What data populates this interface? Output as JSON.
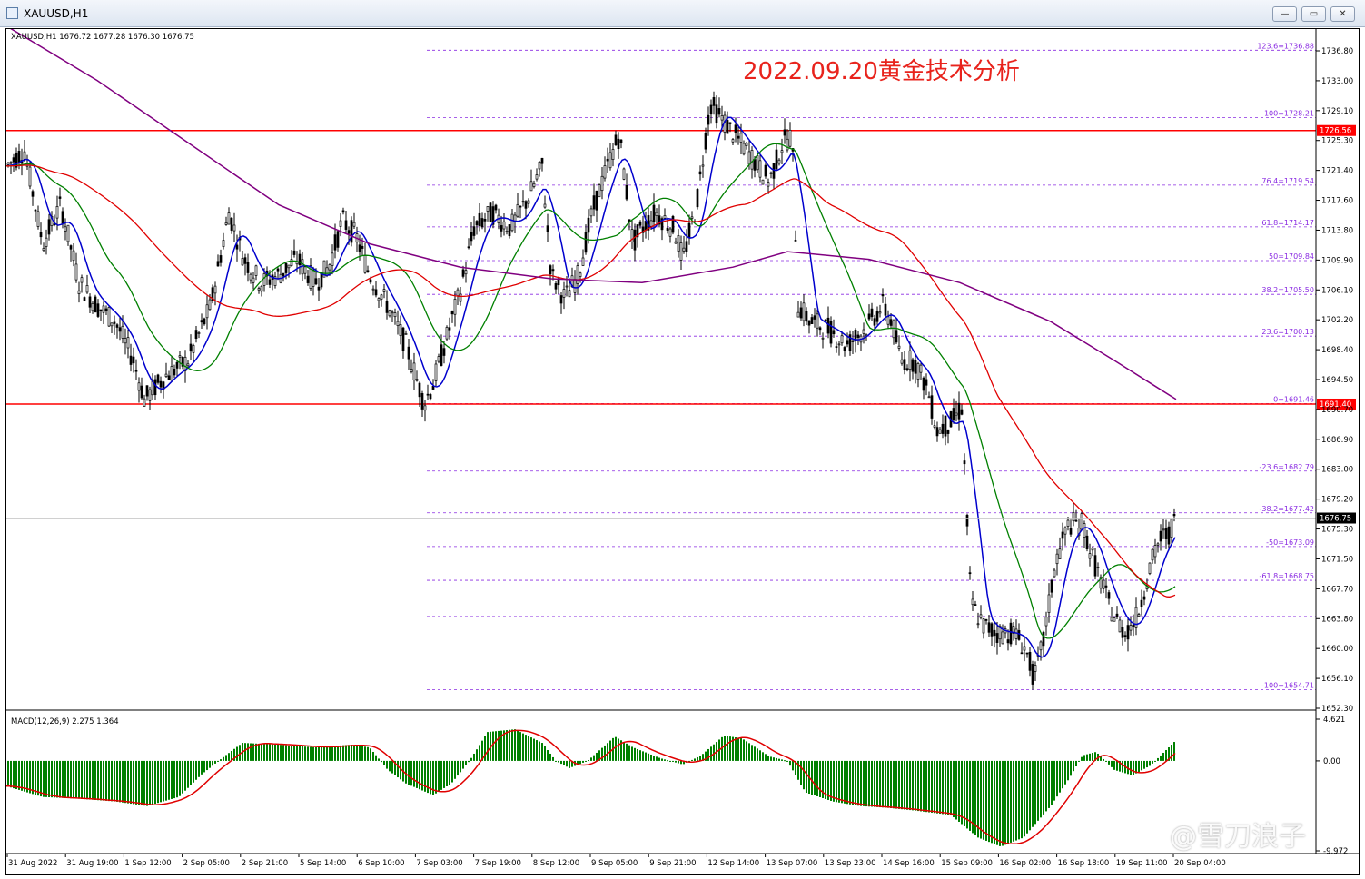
{
  "window": {
    "title": "XAUUSD,H1",
    "buttons": {
      "minimize": "—",
      "restore": "▭",
      "close": "✕"
    }
  },
  "chart": {
    "info_line": "XAUUSD,H1  1676.72 1677.28 1676.30 1676.75",
    "overlay_title": "2022.09.20黄金技术分析",
    "watermark": "@雪刀浪子",
    "price_axis": [
      "1736.80",
      "1733.00",
      "1729.10",
      "1725.30",
      "1721.40",
      "1717.60",
      "1713.80",
      "1709.90",
      "1706.10",
      "1702.20",
      "1698.40",
      "1694.50",
      "1690.70",
      "1686.90",
      "1683.00",
      "1679.20",
      "1675.30",
      "1671.50",
      "1667.70",
      "1663.80",
      "1660.00",
      "1656.10",
      "1652.30"
    ],
    "current_price": "1676.75",
    "horizontal_lines": [
      {
        "label": "1726.56",
        "price": 1726.56,
        "color": "#ff0000"
      },
      {
        "label": "1691.40",
        "price": 1691.4,
        "color": "#ff0000"
      }
    ],
    "fib_levels": [
      {
        "label": "123.6=1736.88",
        "price": 1736.88
      },
      {
        "label": "100=1728.21",
        "price": 1728.21
      },
      {
        "label": "76.4=1719.54",
        "price": 1719.54
      },
      {
        "label": "61.8=1714.17",
        "price": 1714.17
      },
      {
        "label": "50=1709.84",
        "price": 1709.84
      },
      {
        "label": "38.2=1705.50",
        "price": 1705.5
      },
      {
        "label": "23.6=1700.13",
        "price": 1700.13
      },
      {
        "label": "0=1691.46",
        "price": 1691.46
      },
      {
        "label": "-23.6=1682.79",
        "price": 1682.79
      },
      {
        "label": "-38.2=1677.42",
        "price": 1677.42
      },
      {
        "label": "-50=1673.09",
        "price": 1673.09
      },
      {
        "label": "-61.8=1668.75",
        "price": 1668.75
      },
      {
        "label": "",
        "price": 1664.1
      },
      {
        "label": "-100=1654.71",
        "price": 1654.71
      }
    ],
    "time_axis": [
      "31 Aug 2022",
      "31 Aug 19:00",
      "1 Sep 12:00",
      "2 Sep 05:00",
      "2 Sep 21:00",
      "5 Sep 14:00",
      "6 Sep 10:00",
      "7 Sep 03:00",
      "7 Sep 19:00",
      "8 Sep 12:00",
      "9 Sep 05:00",
      "9 Sep 21:00",
      "12 Sep 14:00",
      "13 Sep 07:00",
      "13 Sep 23:00",
      "14 Sep 16:00",
      "15 Sep 09:00",
      "16 Sep 02:00",
      "16 Sep 18:00",
      "19 Sep 11:00",
      "20 Sep 04:00"
    ],
    "colors": {
      "up": "#000000",
      "fast_ma": "#0000cd",
      "mid_ma": "#008000",
      "slow_ma": "#e00000",
      "long_ma": "#800080",
      "hline": "#ff0000",
      "fib": "#8a2be2",
      "macd_hist": "#008000",
      "macd_signal": "#e00000"
    },
    "macd": {
      "label": "MACD(12,26,9) 2.275 1.364",
      "axis": [
        "4.621",
        "0.00",
        "-9.972"
      ]
    }
  }
}
